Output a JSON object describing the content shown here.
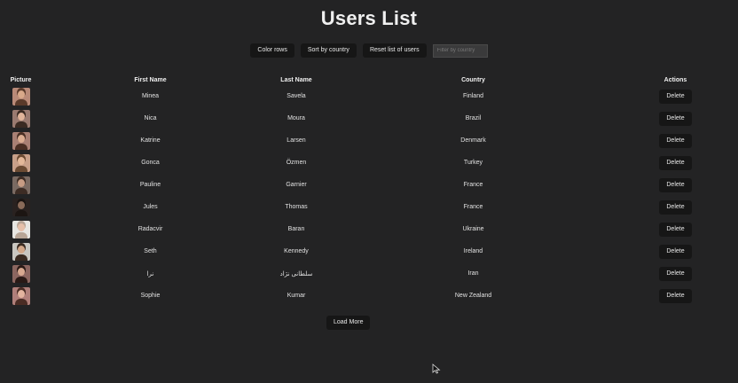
{
  "page": {
    "title": "Users List"
  },
  "toolbar": {
    "color_rows_label": "Color rows",
    "sort_by_country_label": "Sort by country",
    "reset_label": "Reset list of users",
    "filter_placeholder": "Filter by country"
  },
  "table": {
    "headers": {
      "picture": "Picture",
      "first_name": "First Name",
      "last_name": "Last Name",
      "country": "Country",
      "actions": "Actions"
    },
    "delete_label": "Delete",
    "rows": [
      {
        "first": "Minea",
        "last": "Savela",
        "country": "Finland",
        "skin": "#d9a98a",
        "hair": "#5a3a2a",
        "bg": "#b98a78"
      },
      {
        "first": "Nica",
        "last": "Moura",
        "country": "Brazil",
        "skin": "#e0b49a",
        "hair": "#3a2a22",
        "bg": "#9a7a70"
      },
      {
        "first": "Katrine",
        "last": "Larsen",
        "country": "Denmark",
        "skin": "#dcae92",
        "hair": "#4a2f24",
        "bg": "#a98074"
      },
      {
        "first": "Gonca",
        "last": "Özmen",
        "country": "Turkey",
        "skin": "#e3b899",
        "hair": "#6a4a32",
        "bg": "#c8a089"
      },
      {
        "first": "Pauline",
        "last": "Garnier",
        "country": "France",
        "skin": "#c79c84",
        "hair": "#3d2c24",
        "bg": "#7a6a62"
      },
      {
        "first": "Jules",
        "last": "Thomas",
        "country": "France",
        "skin": "#8a6a58",
        "hair": "#1c1512",
        "bg": "#2a2220"
      },
      {
        "first": "Radacvir",
        "last": "Baran",
        "country": "Ukraine",
        "skin": "#e6c0aa",
        "hair": "#b8a596",
        "bg": "#e8e6e2"
      },
      {
        "first": "Seth",
        "last": "Kennedy",
        "country": "Ireland",
        "skin": "#d4a889",
        "hair": "#3a2a20",
        "bg": "#c9c6c0"
      },
      {
        "first": "نرا",
        "last": "سلطانی نژاد",
        "country": "Iran",
        "skin": "#d8a990",
        "hair": "#2a1a16",
        "bg": "#8c6660"
      },
      {
        "first": "Sophie",
        "last": "Kumar",
        "country": "New Zealand",
        "skin": "#e3b49f",
        "hair": "#4a2c24",
        "bg": "#b07f7a"
      }
    ]
  },
  "footer": {
    "load_more_label": "Load More"
  }
}
